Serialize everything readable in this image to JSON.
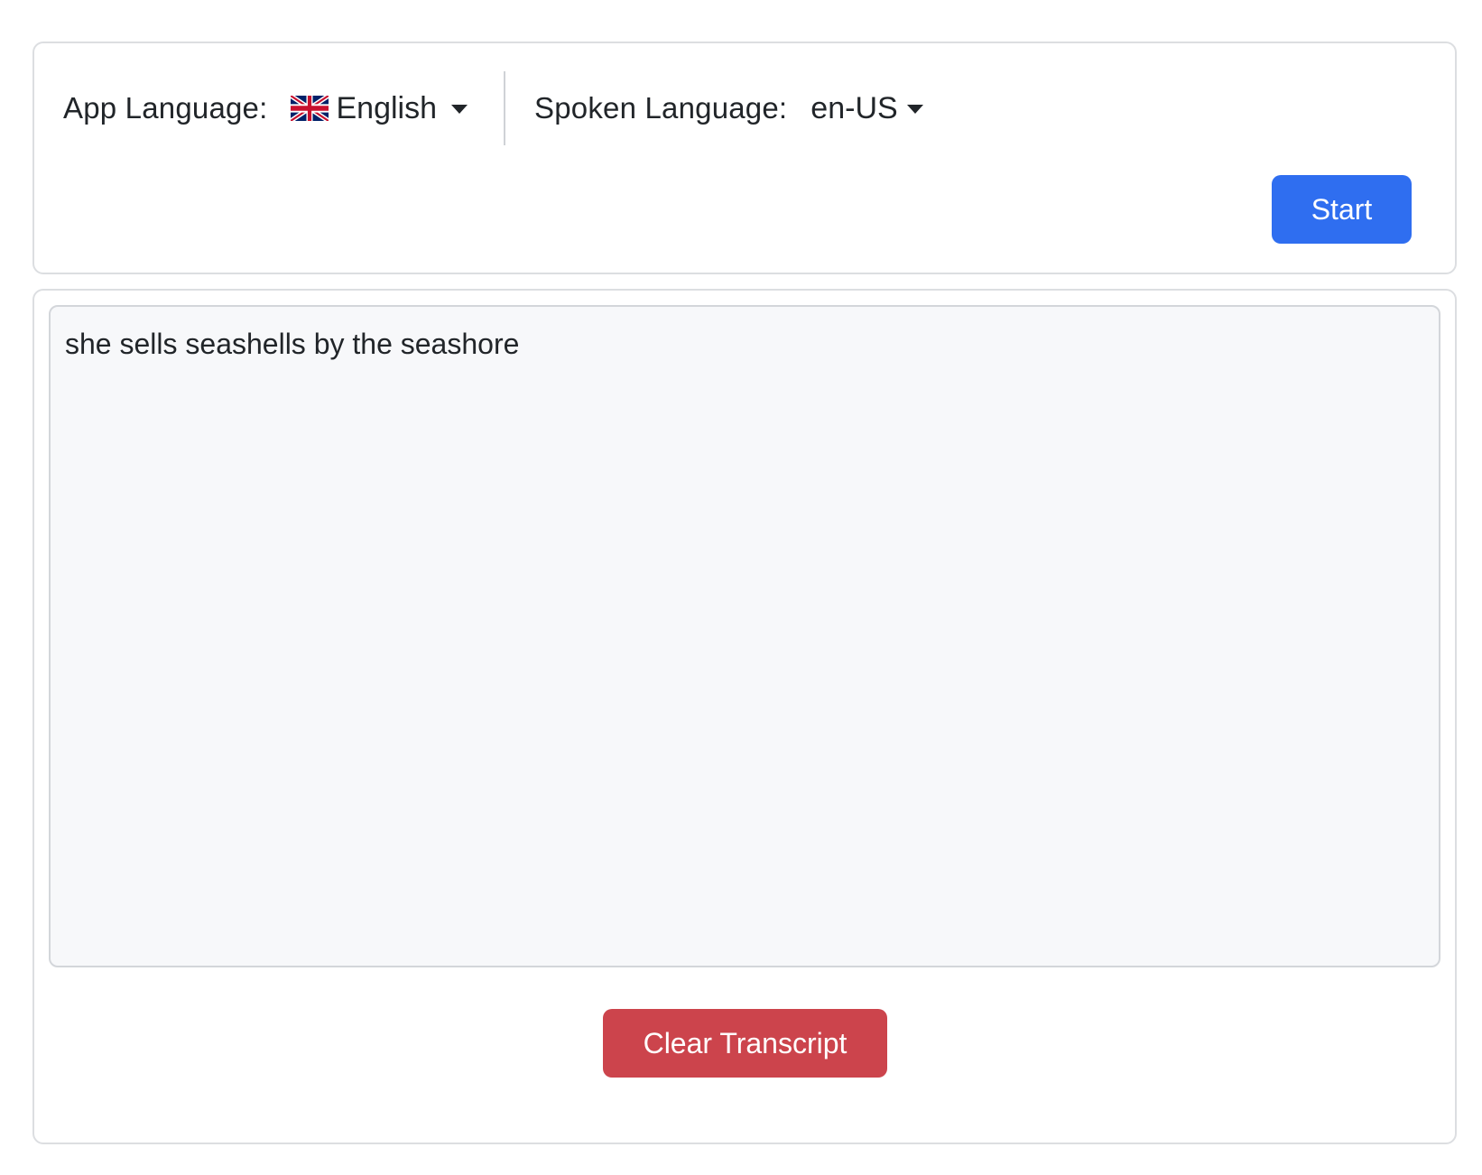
{
  "controls": {
    "app_language_label": "App Language:",
    "app_language_value": "English",
    "app_language_flag": "uk-flag-icon",
    "spoken_language_label": "Spoken Language:",
    "spoken_language_value": "en-US",
    "start_button_label": "Start"
  },
  "transcript": {
    "text": "she sells seashells by the seashore",
    "clear_button_label": "Clear Transcript"
  },
  "colors": {
    "primary": "#2f6ef0",
    "danger": "#cc444c",
    "transcript_background": "#f7f8fa",
    "border": "#dcdee1"
  }
}
